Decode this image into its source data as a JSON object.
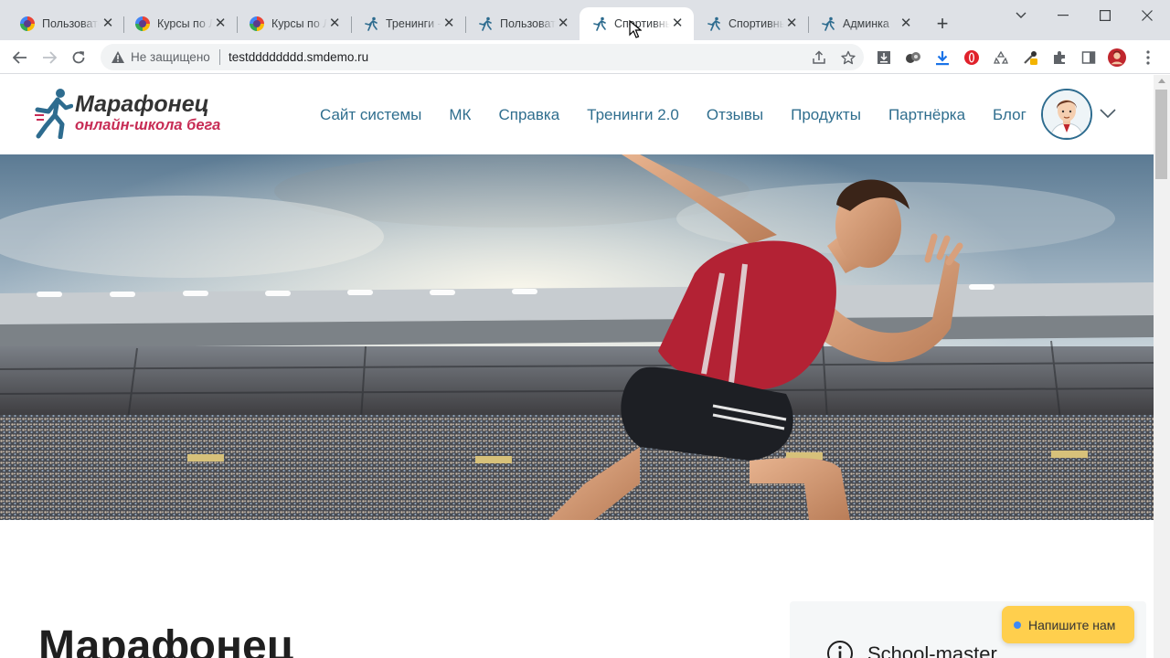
{
  "browser": {
    "tabs": [
      {
        "label": "Пользовате",
        "icon": "colorful-circle-favicon",
        "active": false
      },
      {
        "label": "Курсы по Л",
        "icon": "colorful-circle-favicon",
        "active": false
      },
      {
        "label": "Курсы по Л",
        "icon": "colorful-circle-favicon",
        "active": false
      },
      {
        "label": "Тренинги -",
        "icon": "runner-favicon",
        "active": false
      },
      {
        "label": "Пользовате",
        "icon": "runner-favicon",
        "active": false
      },
      {
        "label": "Спортивны",
        "icon": "runner-favicon",
        "active": true
      },
      {
        "label": "Спортивны",
        "icon": "runner-favicon",
        "active": false
      },
      {
        "label": "Админка",
        "icon": "runner-favicon",
        "active": false
      }
    ],
    "new_tab": "+",
    "omnibox": {
      "security_label": "Не защищено",
      "url": "testdddddddd.smdemo.ru"
    }
  },
  "site": {
    "logo": {
      "title": "Марафонец",
      "subtitle": "онлайн-школа бега"
    },
    "nav": [
      "Сайт системы",
      "МК",
      "Справка",
      "Тренинги 2.0",
      "Отзывы",
      "Продукты",
      "Партнёрка",
      "Блог"
    ],
    "page_title": "Марафонец",
    "info_card_title": "School-master",
    "chat_button": "Напишите нам"
  },
  "colors": {
    "nav_link": "#2f6e8e",
    "logo_accent": "#c72c55",
    "chat_button_bg": "#ffcf4d",
    "chat_dot": "#3d8af7",
    "tabstrip_bg": "#dee1e6"
  }
}
